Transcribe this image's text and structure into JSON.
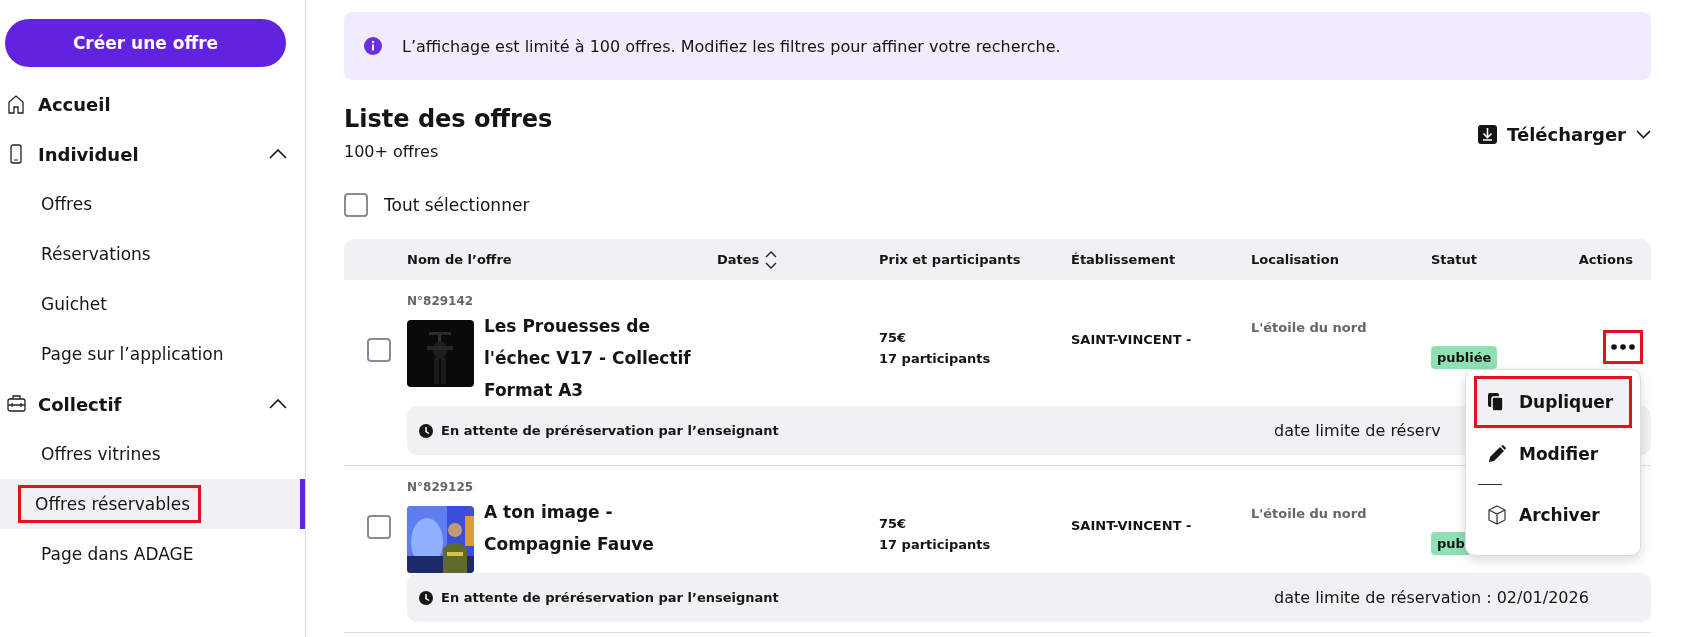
{
  "sidebar": {
    "create_button": "Créer une offre",
    "sections": [
      {
        "label": "Accueil"
      },
      {
        "label": "Individuel",
        "expanded": true,
        "children": [
          {
            "label": "Offres",
            "selected": false,
            "highlighted": false
          },
          {
            "label": "Réservations",
            "selected": false,
            "highlighted": false
          },
          {
            "label": "Guichet",
            "selected": false,
            "highlighted": false
          },
          {
            "label": "Page sur l’application",
            "selected": false,
            "highlighted": false
          }
        ]
      },
      {
        "label": "Collectif",
        "expanded": true,
        "children": [
          {
            "label": "Offres vitrines",
            "selected": false,
            "highlighted": false
          },
          {
            "label": "Offres réservables",
            "selected": true,
            "highlighted": true
          },
          {
            "label": "Page dans ADAGE",
            "selected": false,
            "highlighted": false
          }
        ]
      }
    ]
  },
  "info_banner": "L’affichage est limité à 100 offres. Modifiez les filtres pour affiner votre recherche.",
  "header": {
    "title": "Liste des offres",
    "count": "100+ offres",
    "download": "Télécharger"
  },
  "select_all": {
    "label": "Tout sélectionner",
    "checked": false
  },
  "table": {
    "columns": [
      {
        "label": "Nom de l’offre"
      },
      {
        "label": "Dates",
        "sortable": true
      },
      {
        "label": "Prix et participants"
      },
      {
        "label": "Établissement"
      },
      {
        "label": "Localisation"
      },
      {
        "label": "Statut"
      },
      {
        "label": "Actions"
      }
    ],
    "rows": [
      {
        "checked": false,
        "number": "N°829142",
        "title": "Les Prouesses de l'échec V17 - Collectif Format A3",
        "price": "75€",
        "participants": "17 participants",
        "establishment": "SAINT-VINCENT -",
        "location": "L'étoile du nord",
        "status": "publiée",
        "actions_visible": true,
        "actions_highlighted": true,
        "menu_open": true,
        "pending": "En attente de préréservation par l’enseignant",
        "deadline": "date limite de réserv"
      },
      {
        "checked": false,
        "number": "N°829125",
        "title": "A ton image - Compagnie Fauve",
        "price": "75€",
        "participants": "17 participants",
        "establishment": "SAINT-VINCENT -",
        "location": "L'étoile du nord",
        "status": "pub",
        "actions_visible": false,
        "menu_open": false,
        "pending": "En attente de préréservation par l’enseignant",
        "deadline": "date limite de réservation : 02/01/2026"
      }
    ]
  },
  "actions_menu": [
    {
      "kind": "copy",
      "label": "Dupliquer",
      "highlighted": true
    },
    {
      "kind": "edit",
      "label": "Modifier",
      "highlighted": false
    },
    {
      "kind": "separator"
    },
    {
      "kind": "archive",
      "label": "Archiver",
      "highlighted": false
    }
  ]
}
